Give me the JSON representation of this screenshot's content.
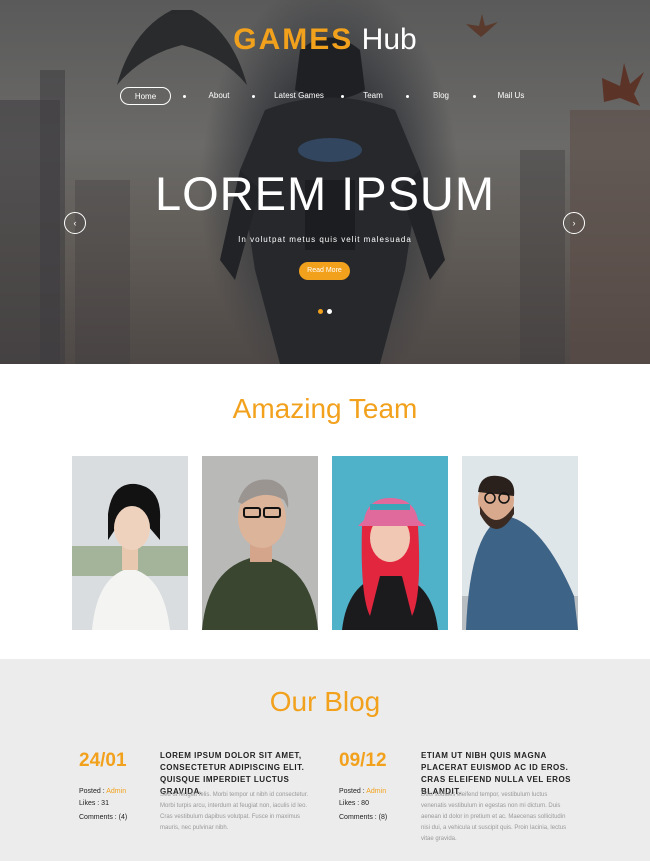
{
  "brand": {
    "part1": "GAMES",
    "part2": "Hub"
  },
  "nav": [
    "Home",
    "About",
    "Latest Games",
    "Team",
    "Blog",
    "Mail Us"
  ],
  "hero": {
    "title": "LOREM IPSUM",
    "subtitle": "In volutpat metus quis velit malesuada",
    "button": "Read More",
    "prev_icon": "chevron-left-icon",
    "next_icon": "chevron-right-icon",
    "slides": 2,
    "active_slide": 1
  },
  "team": {
    "title": "Amazing Team",
    "members": [
      {
        "photo": "woman-white-dress-photo"
      },
      {
        "photo": "man-glasses-green-polo-photo"
      },
      {
        "photo": "woman-red-hair-cap-photo"
      },
      {
        "photo": "bearded-man-denim-shirt-photo"
      }
    ]
  },
  "blog": {
    "title": "Our Blog",
    "posts": [
      {
        "date": "24/01",
        "posted_label": "Posted :",
        "author": "Admin",
        "likes": "Likes : 31",
        "comments": "Comments : (4)",
        "heading": "LOREM IPSUM DOLOR SIT AMET, CONSECTETUR ADIPISCING ELIT. QUISQUE IMPERDIET LUCTUS GRAVIDA.",
        "body": "Sed ut feugiat felis. Morbi tempor ut nibh id consectetur. Morbi turpis arcu, interdum at feugiat non, iaculis id leo. Cras vestibulum dapibus volutpat. Fusce in maximus mauris, nec pulvinar nibh."
      },
      {
        "date": "09/12",
        "posted_label": "Posted :",
        "author": "Admin",
        "likes": "Likes : 80",
        "comments": "Comments : (8)",
        "heading": "ETIAM UT NIBH QUIS MAGNA PLACERAT EUISMOD AC ID EROS. CRAS ELEIFEND NULLA VEL EROS BLANDIT.",
        "body": "Duis sodales eleifend tempor, vestibulum luctus venenatis vestibulum in egestas non mi dictum. Duis aenean id dolor in pretium et ac. Maecenas sollicitudin nisi dui, a vehicula ut suscipit quis. Proin lacinia, lectus vitae gravida."
      }
    ]
  },
  "colors": {
    "accent": "#f2a11c",
    "blog_bg": "#ececec"
  }
}
